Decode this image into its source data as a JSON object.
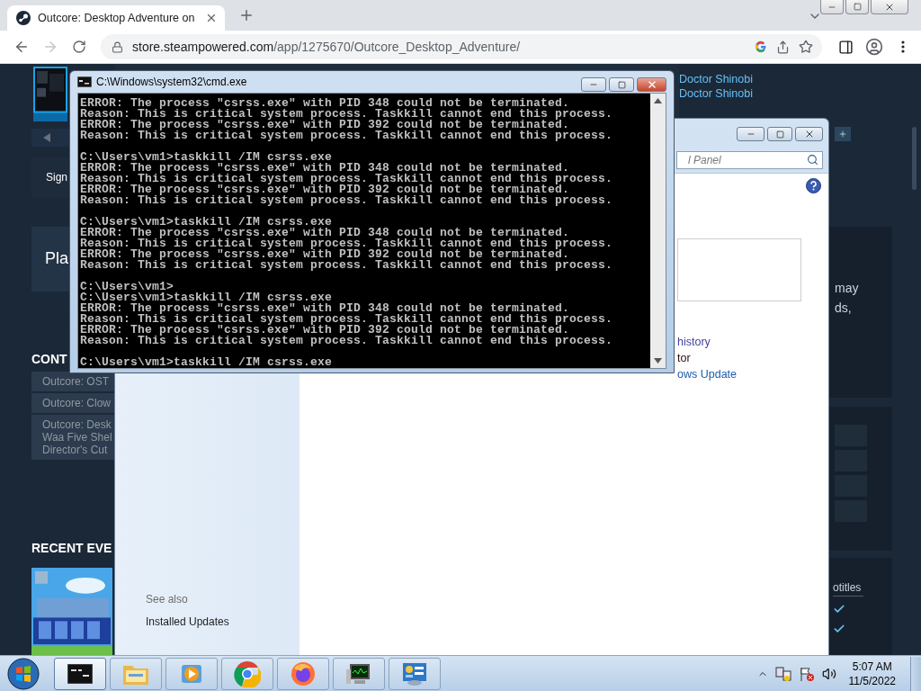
{
  "browser": {
    "tab": {
      "title": "Outcore: Desktop Adventure on"
    },
    "nav": [
      {
        "kind": "back",
        "disabled": false
      },
      {
        "kind": "forward",
        "disabled": true
      },
      {
        "kind": "reload",
        "disabled": false
      }
    ],
    "url": {
      "host": "store.steampowered.com",
      "path": "/app/1275670/Outcore_Desktop_Adventure/"
    }
  },
  "store_page": {
    "sign_in": "Sign",
    "play_heading": "Pla",
    "content_heading": "CONT",
    "content_items": [
      [
        "Outcore: OST"
      ],
      [
        "Outcore: Clow"
      ],
      [
        "Outcore: Desk",
        "Waa Five Shel",
        "Director's Cut"
      ]
    ],
    "events_heading": "RECENT EVE",
    "developers": [
      "Doctor Shinobi",
      "Doctor Shinobi"
    ],
    "description_fragments": [
      "may",
      "ds,"
    ],
    "features_heading": "otitles",
    "subtitle_checks": [
      {
        "checked": true
      },
      {
        "checked": true
      }
    ]
  },
  "cmd_window": {
    "title": "C:\\Windows\\system32\\cmd.exe",
    "blocks": [
      [
        "ERROR: The process \"csrss.exe\" with PID 348 could not be terminated.",
        "Reason: This is critical system process. Taskkill cannot end this process.",
        "ERROR: The process \"csrss.exe\" with PID 392 could not be terminated.",
        "Reason: This is critical system process. Taskkill cannot end this process."
      ],
      [
        "C:\\Users\\vm1>taskkill /IM csrss.exe",
        "ERROR: The process \"csrss.exe\" with PID 348 could not be terminated.",
        "Reason: This is critical system process. Taskkill cannot end this process.",
        "ERROR: The process \"csrss.exe\" with PID 392 could not be terminated.",
        "Reason: This is critical system process. Taskkill cannot end this process."
      ],
      [
        "C:\\Users\\vm1>taskkill /IM csrss.exe",
        "ERROR: The process \"csrss.exe\" with PID 348 could not be terminated.",
        "Reason: This is critical system process. Taskkill cannot end this process.",
        "ERROR: The process \"csrss.exe\" with PID 392 could not be terminated.",
        "Reason: This is critical system process. Taskkill cannot end this process."
      ],
      [
        "C:\\Users\\vm1>",
        "C:\\Users\\vm1>taskkill /IM csrss.exe",
        "ERROR: The process \"csrss.exe\" with PID 348 could not be terminated.",
        "Reason: This is critical system process. Taskkill cannot end this process.",
        "ERROR: The process \"csrss.exe\" with PID 392 could not be terminated.",
        "Reason: This is critical system process. Taskkill cannot end this process."
      ],
      [
        "C:\\Users\\vm1>taskkill /IM csrss.exe"
      ]
    ]
  },
  "control_panel": {
    "search": {
      "placeholder": "l Panel"
    },
    "links": [
      {
        "text": "history",
        "color": "#44449e"
      },
      {
        "text": "tor",
        "color": "#2e0a0a"
      },
      {
        "text": "ows Update",
        "color": "#1a5cb0"
      }
    ],
    "see_also": {
      "heading": "See also",
      "links": [
        "Installed Updates"
      ]
    }
  },
  "taskbar": {
    "apps": [
      {
        "kind": "console",
        "active": true
      },
      {
        "kind": "folders",
        "active": false
      },
      {
        "kind": "media",
        "active": false
      },
      {
        "kind": "chrome",
        "active": false
      },
      {
        "kind": "firefox",
        "active": false
      },
      {
        "kind": "monitor",
        "active": false
      },
      {
        "kind": "control_panel",
        "active": false
      }
    ],
    "clock": {
      "time": "5:07 AM",
      "date": "11/5/2022"
    }
  }
}
